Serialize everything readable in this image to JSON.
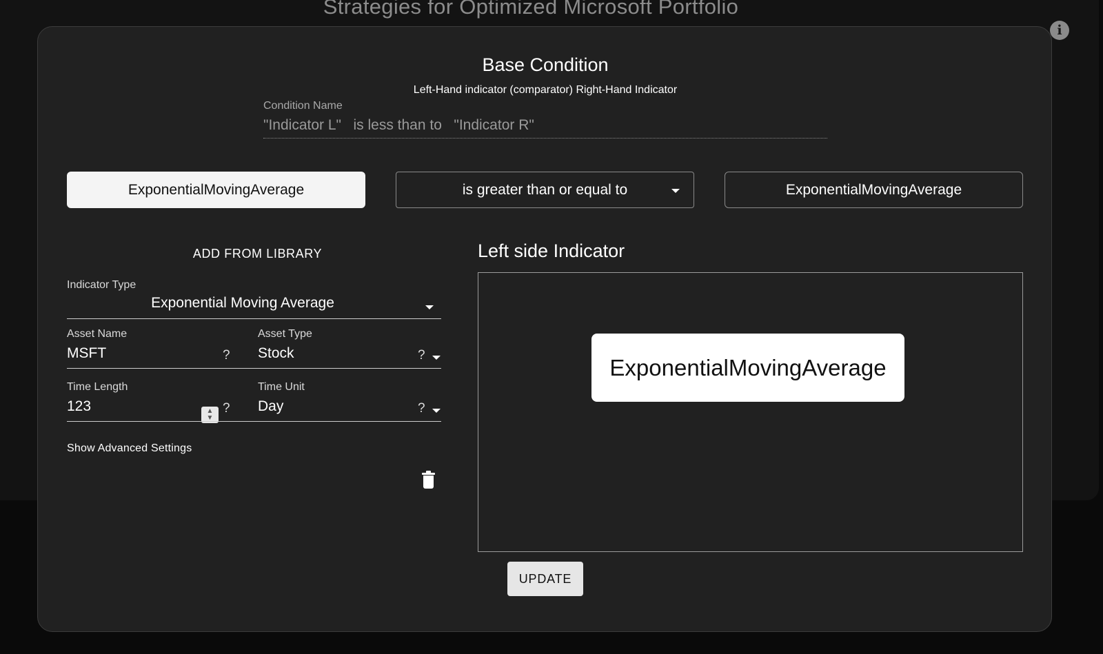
{
  "background": {
    "title": "Strategies for Optimized Microsoft Portfolio",
    "info_icon": "info-icon"
  },
  "modal": {
    "title": "Base Condition",
    "subtitle": "Left-Hand indicator (comparator) Right-Hand Indicator",
    "condition_name": {
      "label": "Condition Name",
      "placeholder": "\"Indicator L\"   is less than to   \"Indicator R\""
    },
    "left_indicator_button": "ExponentialMovingAverage",
    "comparator_select": {
      "value": "is greater than or equal to",
      "icon": "chevron-down-icon"
    },
    "right_indicator_button": "ExponentialMovingAverage",
    "library": {
      "add_from_library": "ADD FROM LIBRARY",
      "indicator_type": {
        "label": "Indicator Type",
        "value": "Exponential Moving Average"
      },
      "asset_name": {
        "label": "Asset Name",
        "value": "MSFT",
        "help": "?"
      },
      "asset_type": {
        "label": "Asset Type",
        "value": "Stock",
        "help": "?"
      },
      "time_length": {
        "label": "Time Length",
        "value": "123",
        "help": "?"
      },
      "time_unit": {
        "label": "Time Unit",
        "value": "Day",
        "help": "?"
      },
      "advanced_settings": "Show Advanced Settings",
      "delete_icon": "trash-icon"
    },
    "preview": {
      "title": "Left side Indicator",
      "node_label": "ExponentialMovingAverage"
    },
    "update_button": "UPDATE"
  },
  "colors": {
    "page_background": "#0a0a0a",
    "modal_background": "#212121",
    "primary_button": "#f4f4f4",
    "text": "#ffffff",
    "muted_text": "#9a9a9a"
  }
}
